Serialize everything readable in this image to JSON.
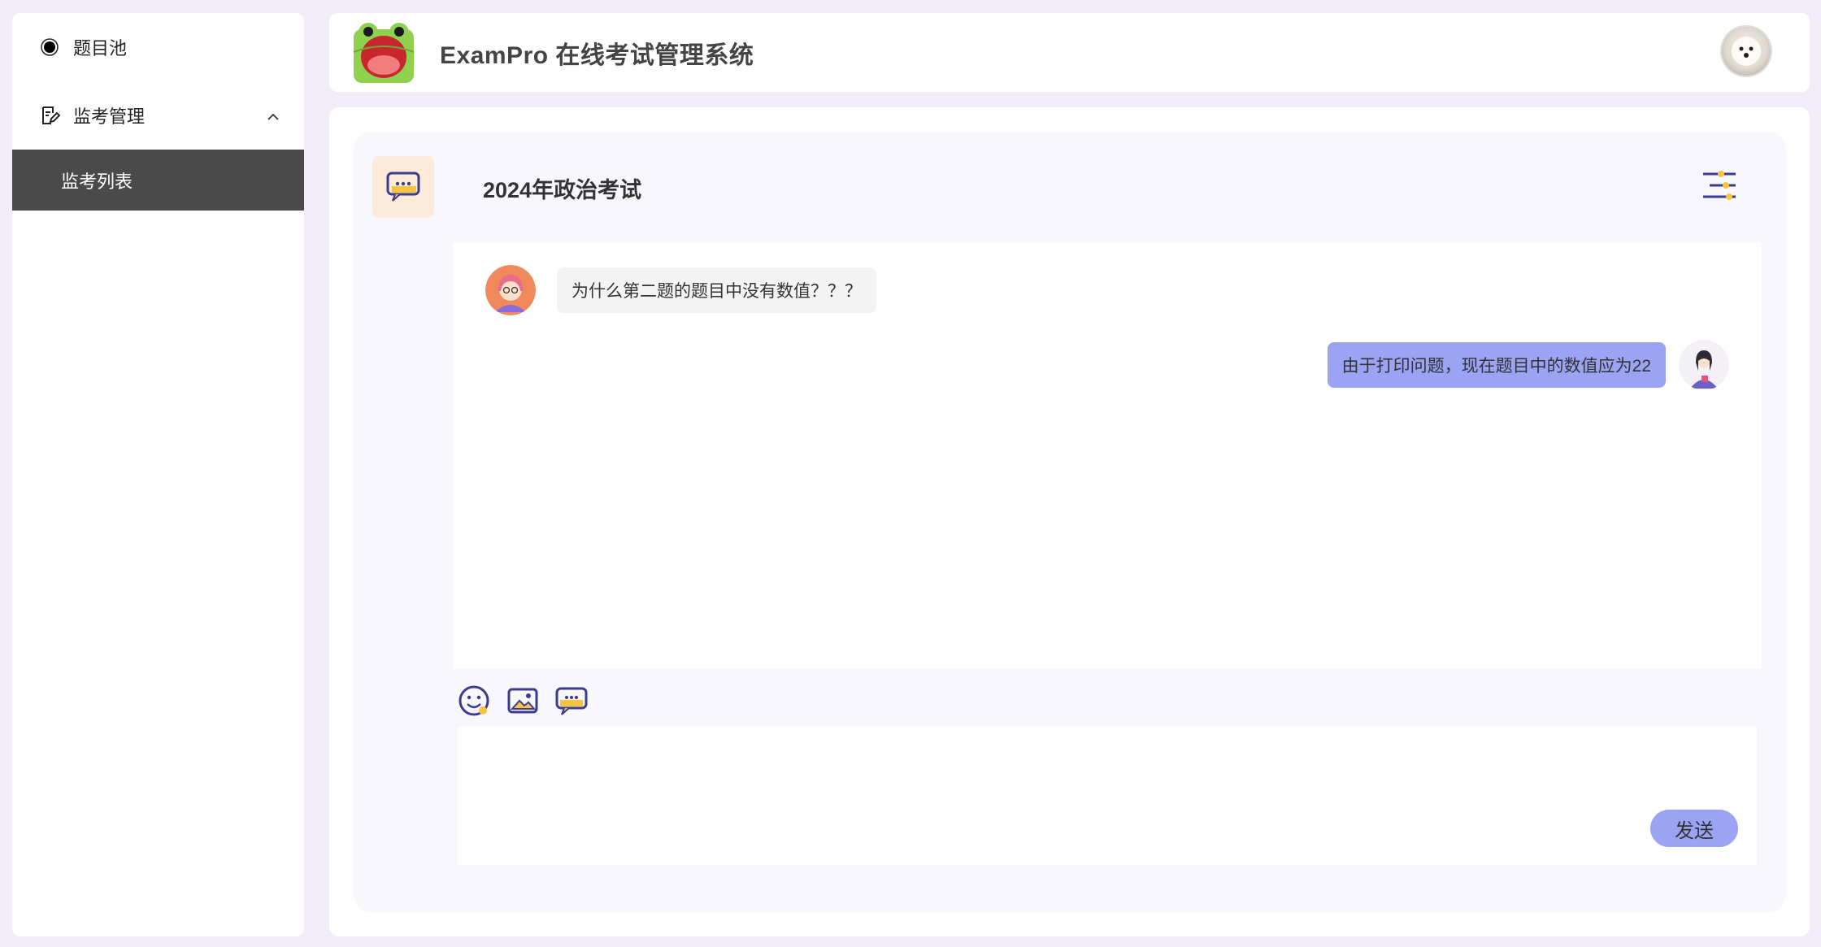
{
  "app": {
    "title": "ExamPro 在线考试管理系统"
  },
  "sidebar": {
    "items": [
      {
        "label": "题目池",
        "icon": "circle-dot-icon"
      },
      {
        "label": "监考管理",
        "icon": "edit-doc-icon",
        "expanded": true,
        "children": [
          {
            "label": "监考列表",
            "active": true
          }
        ]
      }
    ]
  },
  "chat": {
    "room_title": "2024年政治考试",
    "messages": [
      {
        "side": "left",
        "text": "为什么第二题的题目中没有数值？？？"
      },
      {
        "side": "right",
        "text": "由于打印问题，现在题目中的数值应为22"
      }
    ],
    "toolbar": [
      "emoji-icon",
      "image-icon",
      "chat-bubble-icon"
    ],
    "input_placeholder": "",
    "send_label": "发送"
  },
  "colors": {
    "accent": "#9aa3f4",
    "active_nav": "#4a4a4a",
    "page_bg": "#f1ecf7",
    "icon_stroke": "#3d3b8e",
    "icon_yellow": "#f5c542"
  }
}
